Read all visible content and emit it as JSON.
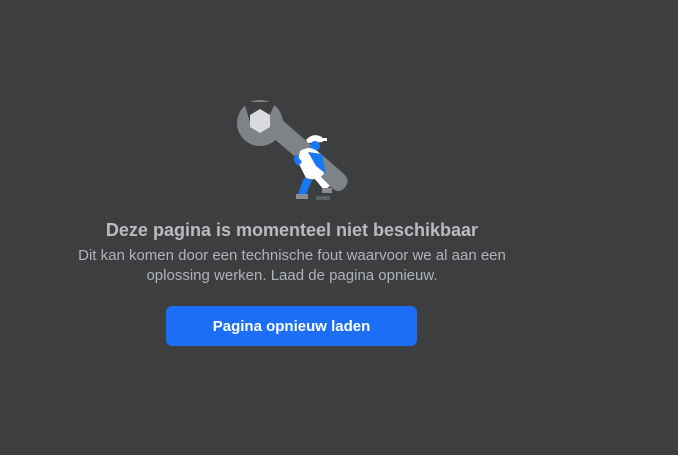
{
  "error": {
    "title": "Deze pagina is momenteel niet beschikbaar",
    "message": "Dit kan komen door een technische fout waarvoor we al aan een oplossing werken. Laad de pagina opnieuw.",
    "reload_label": "Pagina opnieuw laden",
    "illustration_icon": "wrench-worker-icon"
  },
  "colors": {
    "background": "#3d3e40",
    "accent": "#1b6ef5",
    "title_text": "#b9bbbe",
    "body_text": "#b0b3b8"
  }
}
